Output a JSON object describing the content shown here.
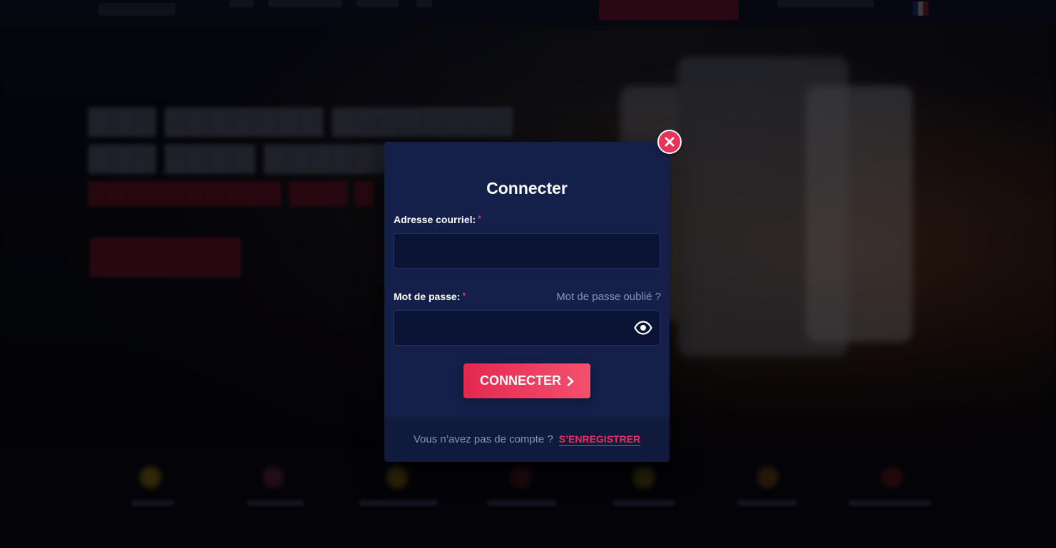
{
  "modal": {
    "title": "Connecter",
    "email_label": "Adresse courriel:",
    "email_value": "",
    "password_label": "Mot de passe:",
    "password_value": "",
    "required_marker": "*",
    "forgot_password": "Mot de passe oublié ?",
    "submit_label": "CONNECTER",
    "no_account_text": "Vous n’avez pas de compte ?",
    "register_link": "S’ENREGISTRER"
  },
  "icons": {
    "close": "close-icon",
    "show_password": "eye-icon",
    "submit_arrow": "chevron-right-icon"
  },
  "colors": {
    "accent": "#e83259",
    "modal_bg": "#14204a",
    "input_bg": "#0b1434",
    "muted_text": "#8b93b2"
  }
}
